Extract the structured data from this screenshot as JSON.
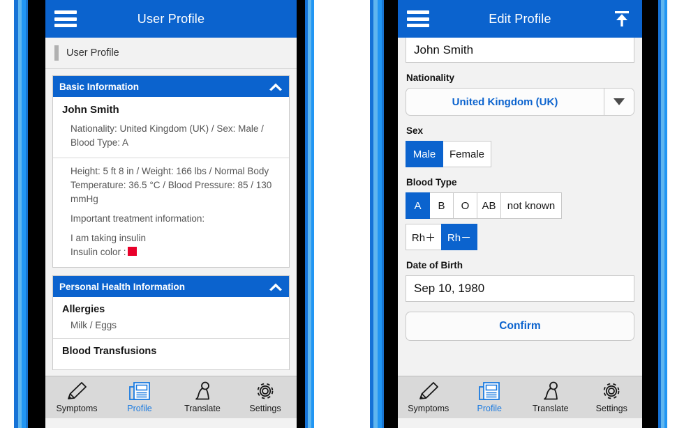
{
  "colors": {
    "brand_blue": "#0b63ce",
    "accent_link": "#1a7ae0",
    "insulin_swatch_red": "#e8002a",
    "tabbar_bg": "#d9d9d9",
    "screen_bg": "#f2f2f2"
  },
  "phones": {
    "left": {
      "navbar": {
        "menu_icon": "hamburger-icon",
        "title": "User Profile"
      },
      "breadcrumb": {
        "label": "User Profile"
      },
      "cards": [
        {
          "header": "Basic Information",
          "toggle_icon": "chevron-up-icon",
          "sections": [
            {
              "name": "John Smith",
              "detail": "Nationality: United Kingdom (UK) / Sex: Male / Blood Type: A"
            },
            {
              "vitals": "Height: 5 ft 8 in / Weight: 166 lbs / Normal Body Temperature: 36.5 °C / Blood Pressure: 85 / 130 mmHg",
              "treatment_label": "Important treatment information:",
              "treatment_line1": "I am taking insulin",
              "treatment_line2": "Insulin color :"
            }
          ]
        },
        {
          "header": "Personal Health Information",
          "toggle_icon": "chevron-up-icon",
          "sections": [
            {
              "title": "Allergies",
              "value": "Milk / Eggs"
            },
            {
              "title": "Blood Transfusions",
              "value": ""
            }
          ]
        }
      ]
    },
    "right": {
      "navbar": {
        "menu_icon": "hamburger-icon",
        "title": "Edit Profile",
        "action_icon": "scroll-to-top-icon"
      },
      "form": {
        "name_value": "John Smith",
        "nationality_label": "Nationality",
        "nationality_value": "United Kingdom (UK)",
        "nationality_caret_icon": "chevron-down-icon",
        "sex_label": "Sex",
        "sex_options": [
          "Male",
          "Female"
        ],
        "sex_selected": "Male",
        "blood_type_label": "Blood Type",
        "blood_type_options": [
          "A",
          "B",
          "O",
          "AB",
          "not known"
        ],
        "blood_type_selected": "A",
        "rh_options": [
          "Rh＋",
          "Rh－"
        ],
        "rh_selected": "Rh－",
        "dob_label": "Date of Birth",
        "dob_value": "Sep 10, 1980",
        "confirm_label": "Confirm"
      }
    }
  },
  "tabbar": {
    "items": [
      {
        "label": "Symptoms",
        "icon": "pencil-icon",
        "active": false
      },
      {
        "label": "Profile",
        "icon": "document-icon",
        "active": true
      },
      {
        "label": "Translate",
        "icon": "person-icon",
        "active": false
      },
      {
        "label": "Settings",
        "icon": "gear-icon",
        "active": false
      }
    ]
  }
}
